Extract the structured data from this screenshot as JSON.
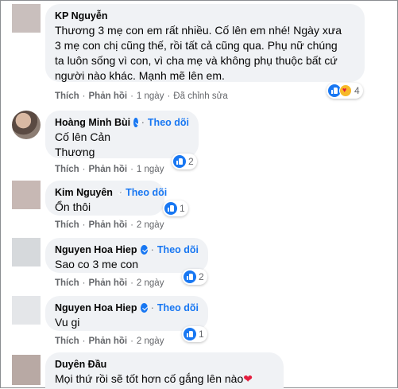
{
  "comments": [
    {
      "name": "KP Nguyễn",
      "verified": false,
      "follow": "",
      "lines": [
        "Thương 3 mẹ con em rất nhiều. Cố lên em nhé! Ngày xưa",
        "3 mẹ con chị cũng thế, rồi tất cả cũng qua. Phụ nữ chúng",
        "ta luôn sống vì con, vì cha mẹ và không phụ thuộc bất cứ",
        "người nào khác. Mạnh mẽ lên em."
      ],
      "actions": {
        "like": "Thích",
        "reply": "Phản hồi",
        "time": "1 ngày",
        "edited": "Đã chỉnh sửa"
      },
      "reactions": "4"
    },
    {
      "name": "Hoàng Minh Bùi",
      "verified": true,
      "follow": "Theo dõi",
      "lines": [
        "Cố lên Cản",
        "Thương"
      ],
      "actions": {
        "like": "Thích",
        "reply": "Phản hồi",
        "time": "1 ngày"
      },
      "reactions": "2"
    },
    {
      "name": "Kim Nguyên",
      "verified": true,
      "follow": "Theo dõi",
      "lines": [
        "Ổn thôi"
      ],
      "actions": {
        "like": "Thích",
        "reply": "Phản hồi",
        "time": "2 ngày"
      },
      "reactions": "1"
    },
    {
      "name": "Nguyen Hoa Hiep",
      "verified": true,
      "follow": "Theo dõi",
      "lines": [
        "Sao co 3 me con"
      ],
      "actions": {
        "like": "Thích",
        "reply": "Phản hồi",
        "time": "2 ngày"
      },
      "reactions": "2"
    },
    {
      "name": "Nguyen Hoa Hiep",
      "verified": true,
      "follow": "Theo dõi",
      "lines": [
        "Vu gi"
      ],
      "actions": {
        "like": "Thích",
        "reply": "Phản hồi",
        "time": "2 ngày"
      },
      "reactions": "1"
    },
    {
      "name": "Duyên Đầu",
      "verified": false,
      "follow": "",
      "lines": [
        "Mọi thứ rồi sẽ tốt hơn cố gắng lên nào"
      ],
      "reactions": ""
    }
  ],
  "dot": "·",
  "colors": {
    "accent": "#1877f2",
    "bubble": "#f0f2f5",
    "meta": "#65676b"
  }
}
